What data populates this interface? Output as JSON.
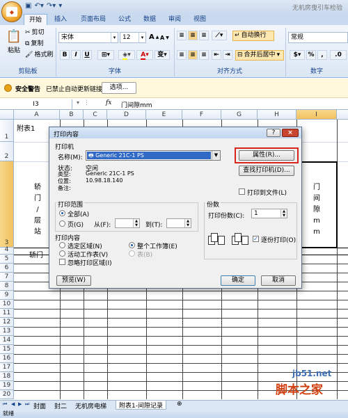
{
  "window": {
    "title": "无机房曳引车检验",
    "qat_icons": [
      "save-icon",
      "undo-icon",
      "redo-icon"
    ]
  },
  "ribbon": {
    "tabs": [
      "开始",
      "插入",
      "页面布局",
      "公式",
      "数据",
      "审阅",
      "视图"
    ],
    "clipboard": {
      "paste": "粘贴",
      "cut": "剪切",
      "copy": "复制",
      "format_painter": "格式刷",
      "group": "剪贴板"
    },
    "font": {
      "name": "宋体",
      "size": "12",
      "bold": "B",
      "italic": "I",
      "underline": "U",
      "group": "字体",
      "grow": "A",
      "shrink": "A",
      "fill_color": "A",
      "wen": "变"
    },
    "alignment": {
      "wrap": "自动换行",
      "merge": "合并后居中",
      "group": "对齐方式"
    },
    "number": {
      "format": "常规",
      "percent": "%",
      "comma": ",",
      "group": "数字",
      "currency": "$",
      "dec": ".0"
    }
  },
  "security": {
    "label": "安全警告",
    "message": "已禁止自动更新链接",
    "options_button": "选项..."
  },
  "formula_bar": {
    "name_box": "I3",
    "fx": "fx",
    "content": "门间隙mm"
  },
  "sheet": {
    "columns": [
      "A",
      "B",
      "C",
      "D",
      "E",
      "F",
      "G",
      "H",
      "I"
    ],
    "rows": [
      "1",
      "2",
      "3",
      "4",
      "5",
      "6",
      "7",
      "8",
      "9",
      "10",
      "11",
      "12",
      "13",
      "14",
      "15",
      "16",
      "17",
      "18",
      "19",
      "20",
      "21"
    ],
    "cells": {
      "a1": "附表1",
      "a3_chars": [
        "轿",
        "门",
        "/",
        "层",
        "站"
      ],
      "a5": "轿门",
      "i3_chars": [
        "门",
        "间",
        "隙",
        "m",
        "m"
      ]
    }
  },
  "sheet_tabs": {
    "nav": [
      "⏮",
      "◀",
      "▶",
      "⏭"
    ],
    "tabs": [
      "封面",
      "封二",
      "无机房电梯",
      "附表1-间隙记录"
    ]
  },
  "status": {
    "text": "就绪"
  },
  "watermark": {
    "site": "jb51.net",
    "name": "脚本之家"
  },
  "dialog": {
    "title": "打印内容",
    "help": "?",
    "close": "×",
    "printer": {
      "section": "打印机",
      "name_label": "名称(M):",
      "name_value": "Generic 21C-1 PS",
      "status_label": "状态:",
      "status_value": "空闲",
      "type_label": "类型:",
      "type_value": "Generic 21C-1 PS",
      "where_label": "位置:",
      "where_value": "10.98.18.140",
      "comment_label": "备注:",
      "comment_value": "",
      "properties_button": "属性(R)...",
      "find_button": "查找打印机(D)...",
      "print_to_file": "打印到文件(L)"
    },
    "range": {
      "section": "打印范围",
      "all": "全部(A)",
      "pages": "页(G)",
      "from": "从(F):",
      "to": "到(T):",
      "from_value": "",
      "to_value": ""
    },
    "what": {
      "section": "打印内容",
      "selection": "选定区域(N)",
      "active": "活动工作表(V)",
      "workbook": "整个工作簿(E)",
      "table": "表(B)",
      "ignore": "忽略打印区域(I)"
    },
    "copies": {
      "section": "份数",
      "count_label": "打印份数(C):",
      "count_value": "1",
      "collate": "逐份打印(O)"
    },
    "preview_button": "预览(W)",
    "ok_button": "确定",
    "cancel_button": "取消"
  },
  "colors": {
    "highlight_border": "#d9241b",
    "ribbon_blue": "#15428b",
    "selection_header": "#f1c15f"
  }
}
